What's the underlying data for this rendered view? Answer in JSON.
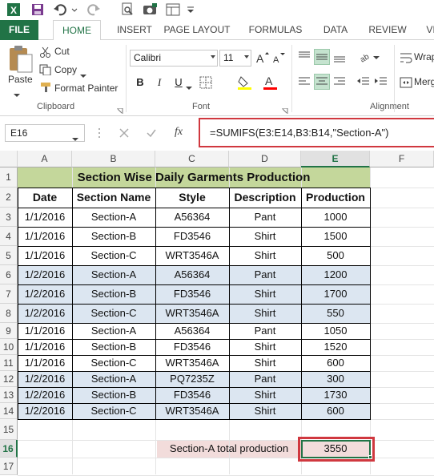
{
  "ribbon_tabs": [
    "FILE",
    "HOME",
    "INSERT",
    "PAGE LAYOUT",
    "FORMULAS",
    "DATA",
    "REVIEW",
    "VI"
  ],
  "clipboard": {
    "paste": "Paste",
    "cut": "Cut",
    "copy": "Copy",
    "format_painter": "Format Painter",
    "label": "Clipboard"
  },
  "font": {
    "name": "Calibri",
    "size": "11",
    "label": "Font"
  },
  "alignment": {
    "wrap": "Wrap",
    "merge": "Merg",
    "label": "Alignment"
  },
  "formula_bar": {
    "name_box": "E16",
    "fx": "fx",
    "formula": "=SUMIFS(E3:E14,B3:B14,\"Section-A\")"
  },
  "columns": [
    "A",
    "B",
    "C",
    "D",
    "E",
    "F"
  ],
  "rows": [
    "1",
    "2",
    "3",
    "4",
    "5",
    "6",
    "7",
    "8",
    "9",
    "10",
    "11",
    "12",
    "13",
    "14",
    "15",
    "16",
    "17"
  ],
  "sheet": {
    "title": "Section Wise Daily Garments Production",
    "headers": [
      "Date",
      "Section Name",
      "Style",
      "Description",
      "Production"
    ],
    "data": [
      [
        "1/1/2016",
        "Section-A",
        "A56364",
        "Pant",
        "1000"
      ],
      [
        "1/1/2016",
        "Section-B",
        "FD3546",
        "Shirt",
        "1500"
      ],
      [
        "1/1/2016",
        "Section-C",
        "WRT3546A",
        "Shirt",
        "500"
      ],
      [
        "1/2/2016",
        "Section-A",
        "A56364",
        "Pant",
        "1200"
      ],
      [
        "1/2/2016",
        "Section-B",
        "FD3546",
        "Shirt",
        "1700"
      ],
      [
        "1/2/2016",
        "Section-C",
        "WRT3546A",
        "Shirt",
        "550"
      ],
      [
        "1/1/2016",
        "Section-A",
        "A56364",
        "Pant",
        "1050"
      ],
      [
        "1/1/2016",
        "Section-B",
        "FD3546",
        "Shirt",
        "1520"
      ],
      [
        "1/1/2016",
        "Section-C",
        "WRT3546A",
        "Shirt",
        "600"
      ],
      [
        "1/2/2016",
        "Section-A",
        "PQ7235Z",
        "Pant",
        "300"
      ],
      [
        "1/2/2016",
        "Section-B",
        "FD3546",
        "Shirt",
        "1730"
      ],
      [
        "1/2/2016",
        "Section-C",
        "WRT3546A",
        "Shirt",
        "600"
      ]
    ],
    "summary_label": "Section-A total production",
    "summary_value": "3550"
  },
  "colors": {
    "excel_green": "#217346",
    "title_fill": "#c4d79b",
    "band_fill": "#dce6f1",
    "summary_fill": "#f2dcdb",
    "highlight_red": "#d0383f"
  }
}
